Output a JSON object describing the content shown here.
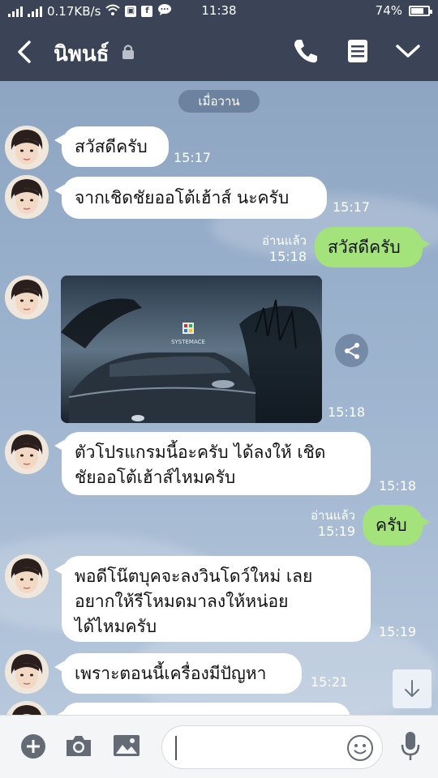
{
  "status_bar": {
    "network_speed": "0.17KB/s",
    "time": "11:38",
    "battery": "74%",
    "battery_level": 0.74
  },
  "header": {
    "contact_name": "นิพนธ์",
    "icons": [
      "back-arrow-icon",
      "lock-icon",
      "phone-icon",
      "memo-icon",
      "chevron-down-icon"
    ]
  },
  "chat": {
    "date_separator": "เมื่อวาน",
    "messages": [
      {
        "direction": "in",
        "text": "สวัสดีครับ",
        "time": "15:17"
      },
      {
        "direction": "in",
        "text": "จากเชิดชัยออโต้เฮ้าส์ นะครับ",
        "time": "15:17"
      },
      {
        "direction": "out",
        "text": "สวัสดีครับ",
        "read": "อ่านแล้ว",
        "time": "15:18"
      },
      {
        "direction": "in",
        "type": "image",
        "image_caption": "SYSTEMACE",
        "time": "15:18"
      },
      {
        "direction": "in",
        "lines": [
          "ตัวโปรแกรมนี้อะครับ ได้ลงให้ เชิด",
          "ชัยออโต้เฮ้าส์ไหมครับ"
        ],
        "time": "15:18"
      },
      {
        "direction": "out",
        "text": "ครับ",
        "read": "อ่านแล้ว",
        "time": "15:19"
      },
      {
        "direction": "in",
        "lines": [
          "พอดีโน๊ตบุคจะลงวินโดว์ใหม่ เลย",
          "อยากให้รีโหมดมาลงให้หน่อย",
          "ได้ไหมครับ"
        ],
        "time": "15:19"
      },
      {
        "direction": "in",
        "text": "เพราะตอนนี้เครื่องมีปัญหา",
        "time": "15:21"
      }
    ]
  },
  "input_bar": {
    "placeholder": "",
    "icons": [
      "plus-icon",
      "camera-icon",
      "gallery-icon",
      "emoji-icon",
      "microphone-icon"
    ]
  },
  "colors": {
    "header_bg": "#3a4456",
    "incoming_bubble": "#ffffff",
    "outgoing_bubble": "#a4e27c",
    "chat_bg": "#9bb2cd"
  }
}
